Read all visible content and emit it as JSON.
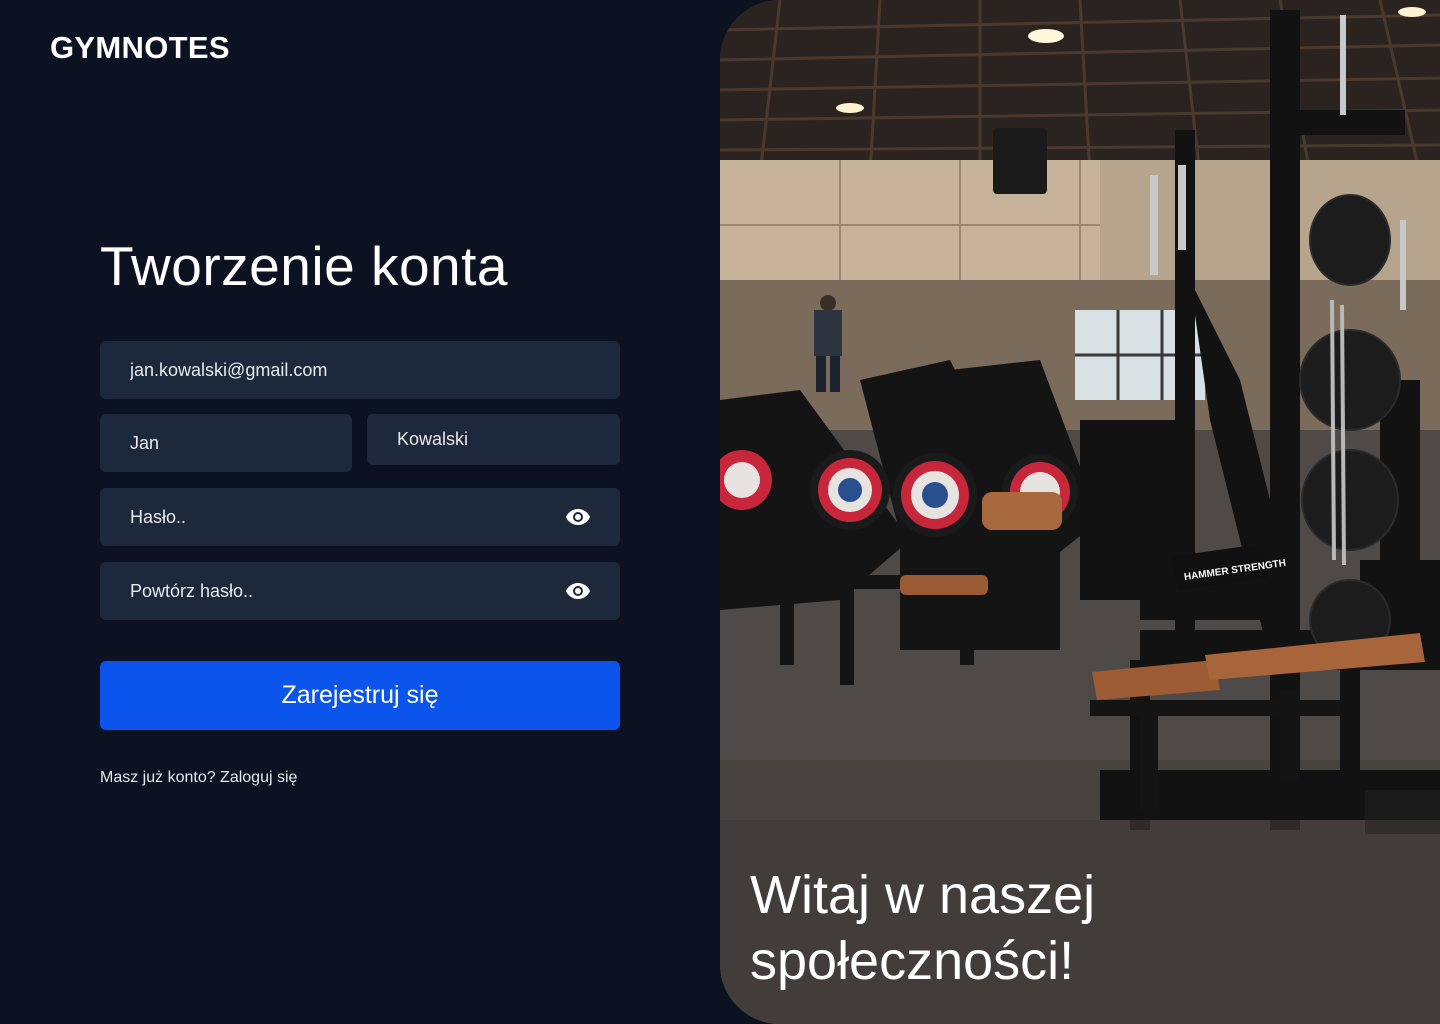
{
  "brand": {
    "logo": "GYMNOTES"
  },
  "form": {
    "title": "Tworzenie konta",
    "email_value": "jan.kowalski@gmail.com",
    "first_name_value": "Jan",
    "last_name_value": "Kowalski",
    "password_placeholder": "Hasło..",
    "password_repeat_placeholder": "Powtórz hasło..",
    "submit_label": "Zarejestruj się",
    "login_link": "Masz już konto? Zaloguj się"
  },
  "hero": {
    "welcome_text": "Witaj w naszej społeczności!",
    "equipment_label": "HAMMER STRENGTH"
  },
  "colors": {
    "background": "#0d1222",
    "field": "#1e283b",
    "accent": "#0b55ec"
  },
  "icons": {
    "password_toggle": "eye-icon"
  }
}
